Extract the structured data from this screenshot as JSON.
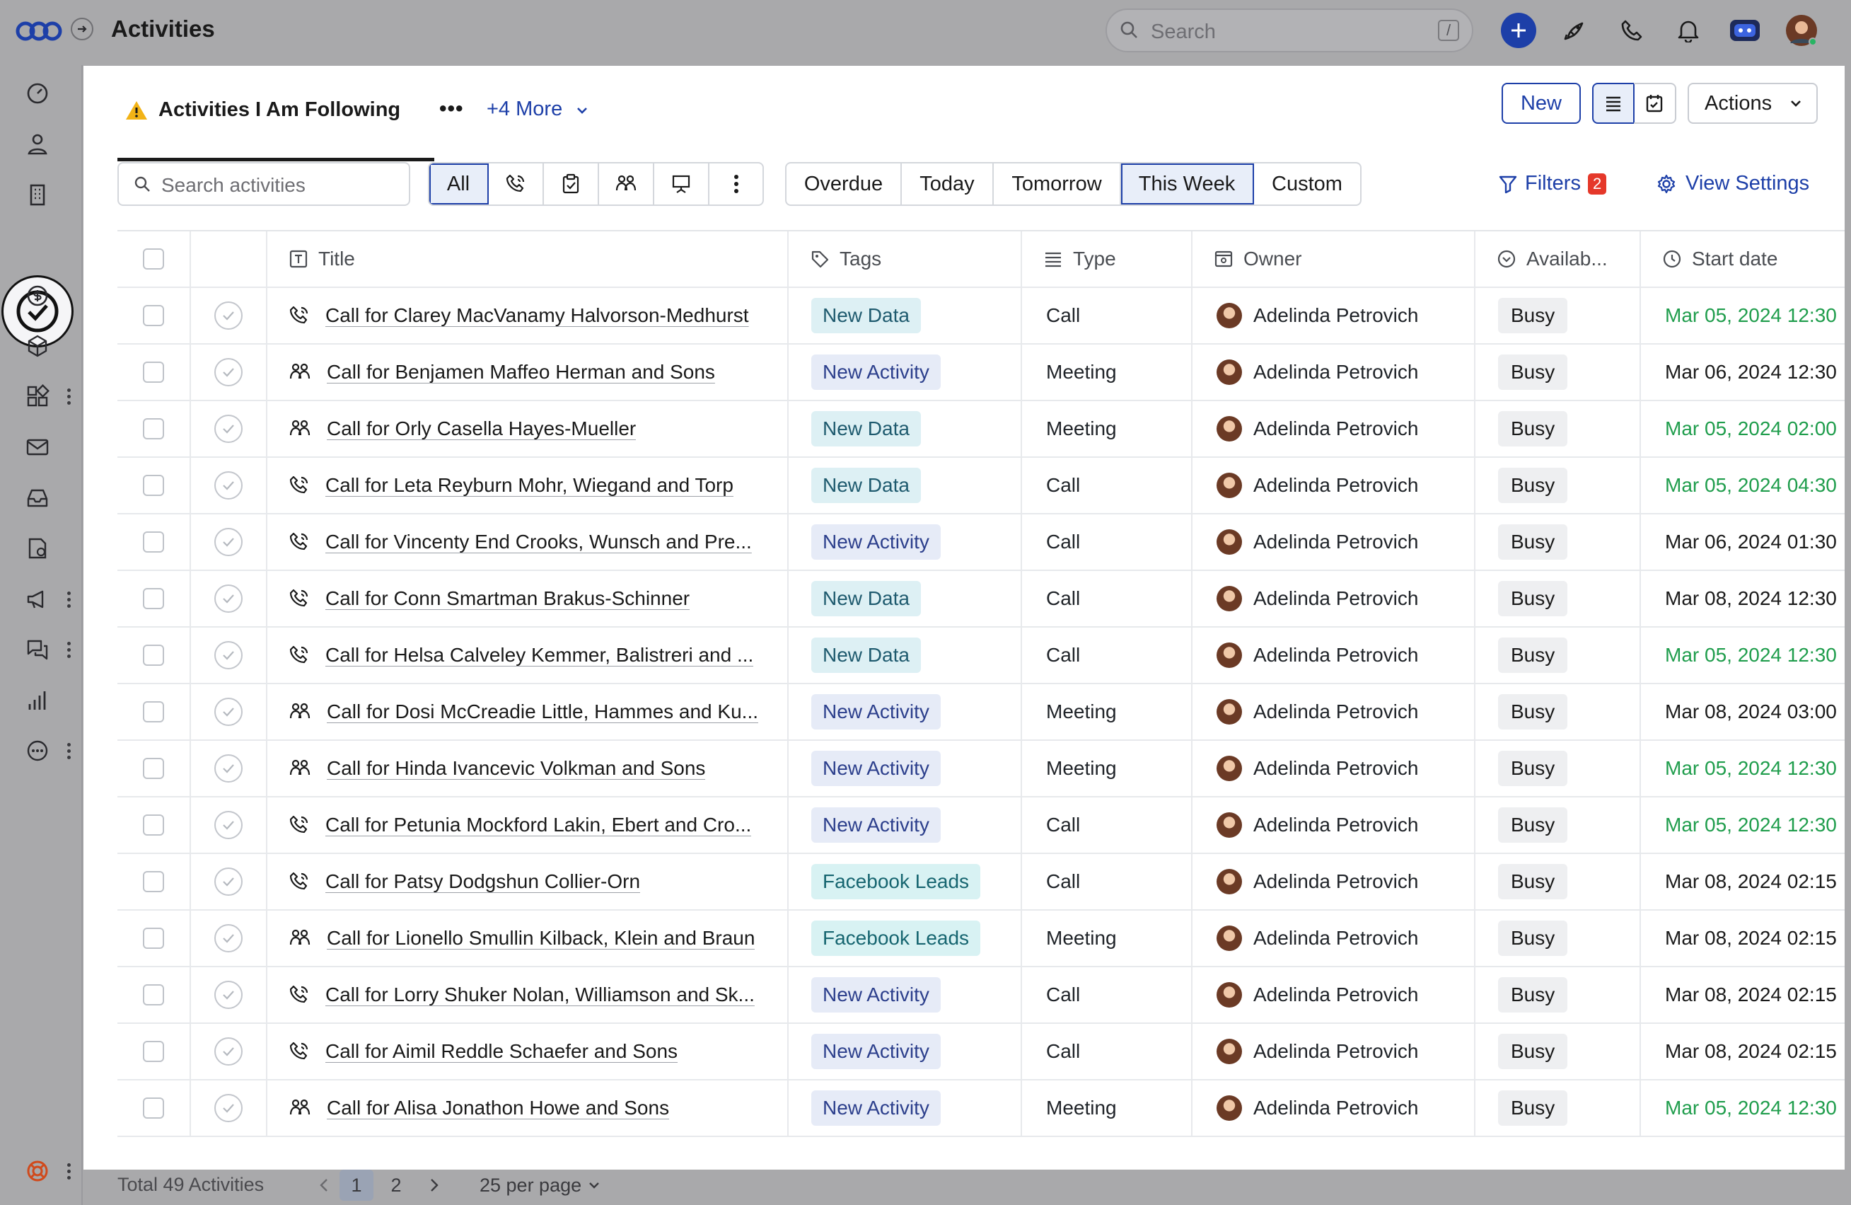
{
  "app": {
    "title": "Activities"
  },
  "topbar": {
    "search_placeholder": "Search",
    "search_shortcut": "/"
  },
  "view": {
    "name": "Activities I Am Following",
    "more_views": "+4 More"
  },
  "toolbar": {
    "new_label": "New",
    "actions_label": "Actions"
  },
  "filterbar": {
    "search_placeholder": "Search activities",
    "type_all": "All",
    "time_filters": [
      "Overdue",
      "Today",
      "Tomorrow",
      "This Week",
      "Custom"
    ],
    "active_time_filter": "This Week",
    "filters_label": "Filters",
    "filters_count": "2",
    "view_settings_label": "View Settings"
  },
  "table": {
    "columns": [
      "Title",
      "Tags",
      "Type",
      "Owner",
      "Availab...",
      "Start date"
    ],
    "rows": [
      {
        "icon": "phone",
        "title": "Call for Clarey MacVanamy Halvorson-Medhurst",
        "tag": "New Data",
        "type": "Call",
        "owner": "Adelinda Petrovich",
        "availability": "Busy",
        "start": "Mar 05, 2024 12:30",
        "start_color": "green"
      },
      {
        "icon": "meeting",
        "title": "Call for Benjamen Maffeo Herman and Sons",
        "tag": "New Activity",
        "type": "Meeting",
        "owner": "Adelinda Petrovich",
        "availability": "Busy",
        "start": "Mar 06, 2024 12:30",
        "start_color": "black"
      },
      {
        "icon": "meeting",
        "title": "Call for Orly Casella Hayes-Mueller",
        "tag": "New Data",
        "type": "Meeting",
        "owner": "Adelinda Petrovich",
        "availability": "Busy",
        "start": "Mar 05, 2024 02:00",
        "start_color": "green"
      },
      {
        "icon": "phone",
        "title": "Call for Leta Reyburn Mohr, Wiegand and Torp",
        "tag": "New Data",
        "type": "Call",
        "owner": "Adelinda Petrovich",
        "availability": "Busy",
        "start": "Mar 05, 2024 04:30",
        "start_color": "green"
      },
      {
        "icon": "phone",
        "title": "Call for Vincenty End Crooks, Wunsch and Pre...",
        "tag": "New Activity",
        "type": "Call",
        "owner": "Adelinda Petrovich",
        "availability": "Busy",
        "start": "Mar 06, 2024 01:30",
        "start_color": "black"
      },
      {
        "icon": "phone",
        "title": "Call for Conn Smartman Brakus-Schinner",
        "tag": "New Data",
        "type": "Call",
        "owner": "Adelinda Petrovich",
        "availability": "Busy",
        "start": "Mar 08, 2024 12:30",
        "start_color": "black"
      },
      {
        "icon": "phone",
        "title": "Call for Helsa Calveley Kemmer, Balistreri and ...",
        "tag": "New Data",
        "type": "Call",
        "owner": "Adelinda Petrovich",
        "availability": "Busy",
        "start": "Mar 05, 2024 12:30",
        "start_color": "green"
      },
      {
        "icon": "meeting",
        "title": "Call for Dosi McCreadie Little, Hammes and Ku...",
        "tag": "New Activity",
        "type": "Meeting",
        "owner": "Adelinda Petrovich",
        "availability": "Busy",
        "start": "Mar 08, 2024 03:00",
        "start_color": "black"
      },
      {
        "icon": "meeting",
        "title": "Call for Hinda Ivancevic Volkman and Sons",
        "tag": "New Activity",
        "type": "Meeting",
        "owner": "Adelinda Petrovich",
        "availability": "Busy",
        "start": "Mar 05, 2024 12:30",
        "start_color": "green"
      },
      {
        "icon": "phone",
        "title": "Call for Petunia Mockford Lakin, Ebert and Cro...",
        "tag": "New Activity",
        "type": "Call",
        "owner": "Adelinda Petrovich",
        "availability": "Busy",
        "start": "Mar 05, 2024 12:30",
        "start_color": "green"
      },
      {
        "icon": "phone",
        "title": "Call for Patsy Dodgshun Collier-Orn",
        "tag": "Facebook Leads",
        "type": "Call",
        "owner": "Adelinda Petrovich",
        "availability": "Busy",
        "start": "Mar 08, 2024 02:15",
        "start_color": "black"
      },
      {
        "icon": "meeting",
        "title": "Call for Lionello Smullin Kilback, Klein and Braun",
        "tag": "Facebook Leads",
        "type": "Meeting",
        "owner": "Adelinda Petrovich",
        "availability": "Busy",
        "start": "Mar 08, 2024 02:15",
        "start_color": "black"
      },
      {
        "icon": "phone",
        "title": "Call for Lorry Shuker Nolan, Williamson and Sk...",
        "tag": "New Activity",
        "type": "Call",
        "owner": "Adelinda Petrovich",
        "availability": "Busy",
        "start": "Mar 08, 2024 02:15",
        "start_color": "black"
      },
      {
        "icon": "phone",
        "title": "Call for Aimil Reddle Schaefer and Sons",
        "tag": "New Activity",
        "type": "Call",
        "owner": "Adelinda Petrovich",
        "availability": "Busy",
        "start": "Mar 08, 2024 02:15",
        "start_color": "black"
      },
      {
        "icon": "meeting",
        "title": "Call for Alisa Jonathon Howe and Sons",
        "tag": "New Activity",
        "type": "Meeting",
        "owner": "Adelinda Petrovich",
        "availability": "Busy",
        "start": "Mar 05, 2024 12:30",
        "start_color": "green"
      }
    ]
  },
  "footer": {
    "total": "Total 49 Activities",
    "pages": [
      "1",
      "2"
    ],
    "current_page": "1",
    "per_page": "25 per page"
  },
  "colors": {
    "accent": "#1d3fa8",
    "overdue_green": "#1f9d4c",
    "badge_red": "#e5382a"
  }
}
